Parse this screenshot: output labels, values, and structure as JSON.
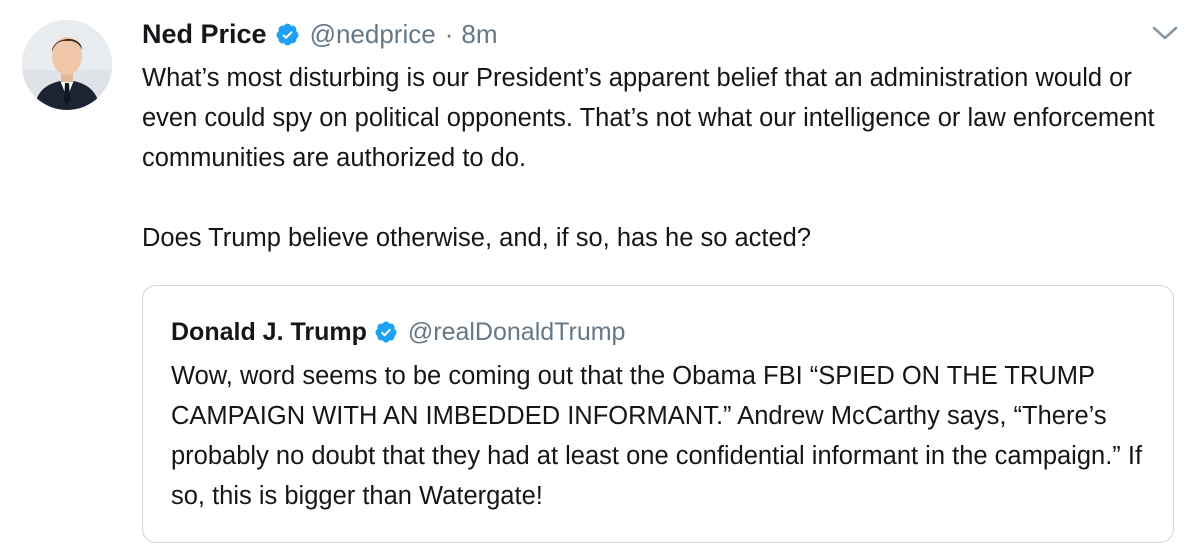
{
  "tweet": {
    "author_name": "Ned Price",
    "author_handle": "@nedprice",
    "separator": "·",
    "time": "8m",
    "text_paragraphs": [
      "What’s most disturbing is our President’s apparent belief that an administration would or even could spy on political opponents. That’s not what our intelligence or law enforcement communities are authorized to do.",
      "Does Trump believe otherwise, and, if so, has he so acted?"
    ],
    "verified_icon": "verified-badge-icon",
    "menu_icon": "chevron-down-icon"
  },
  "quoted_tweet": {
    "author_name": "Donald J. Trump",
    "author_handle": "@realDonaldTrump",
    "text": "Wow, word seems to be coming out that the Obama FBI “SPIED ON THE TRUMP CAMPAIGN WITH AN IMBEDDED INFORMANT.” Andrew McCarthy says, “There’s probably no doubt that they had at least one confidential informant in the campaign.” If so, this is bigger than Watergate!",
    "verified_icon": "verified-badge-icon"
  },
  "colors": {
    "text_primary": "#14171a",
    "text_secondary": "#657786",
    "verified_blue": "#1da1f2",
    "border": "#ccd6dd"
  }
}
